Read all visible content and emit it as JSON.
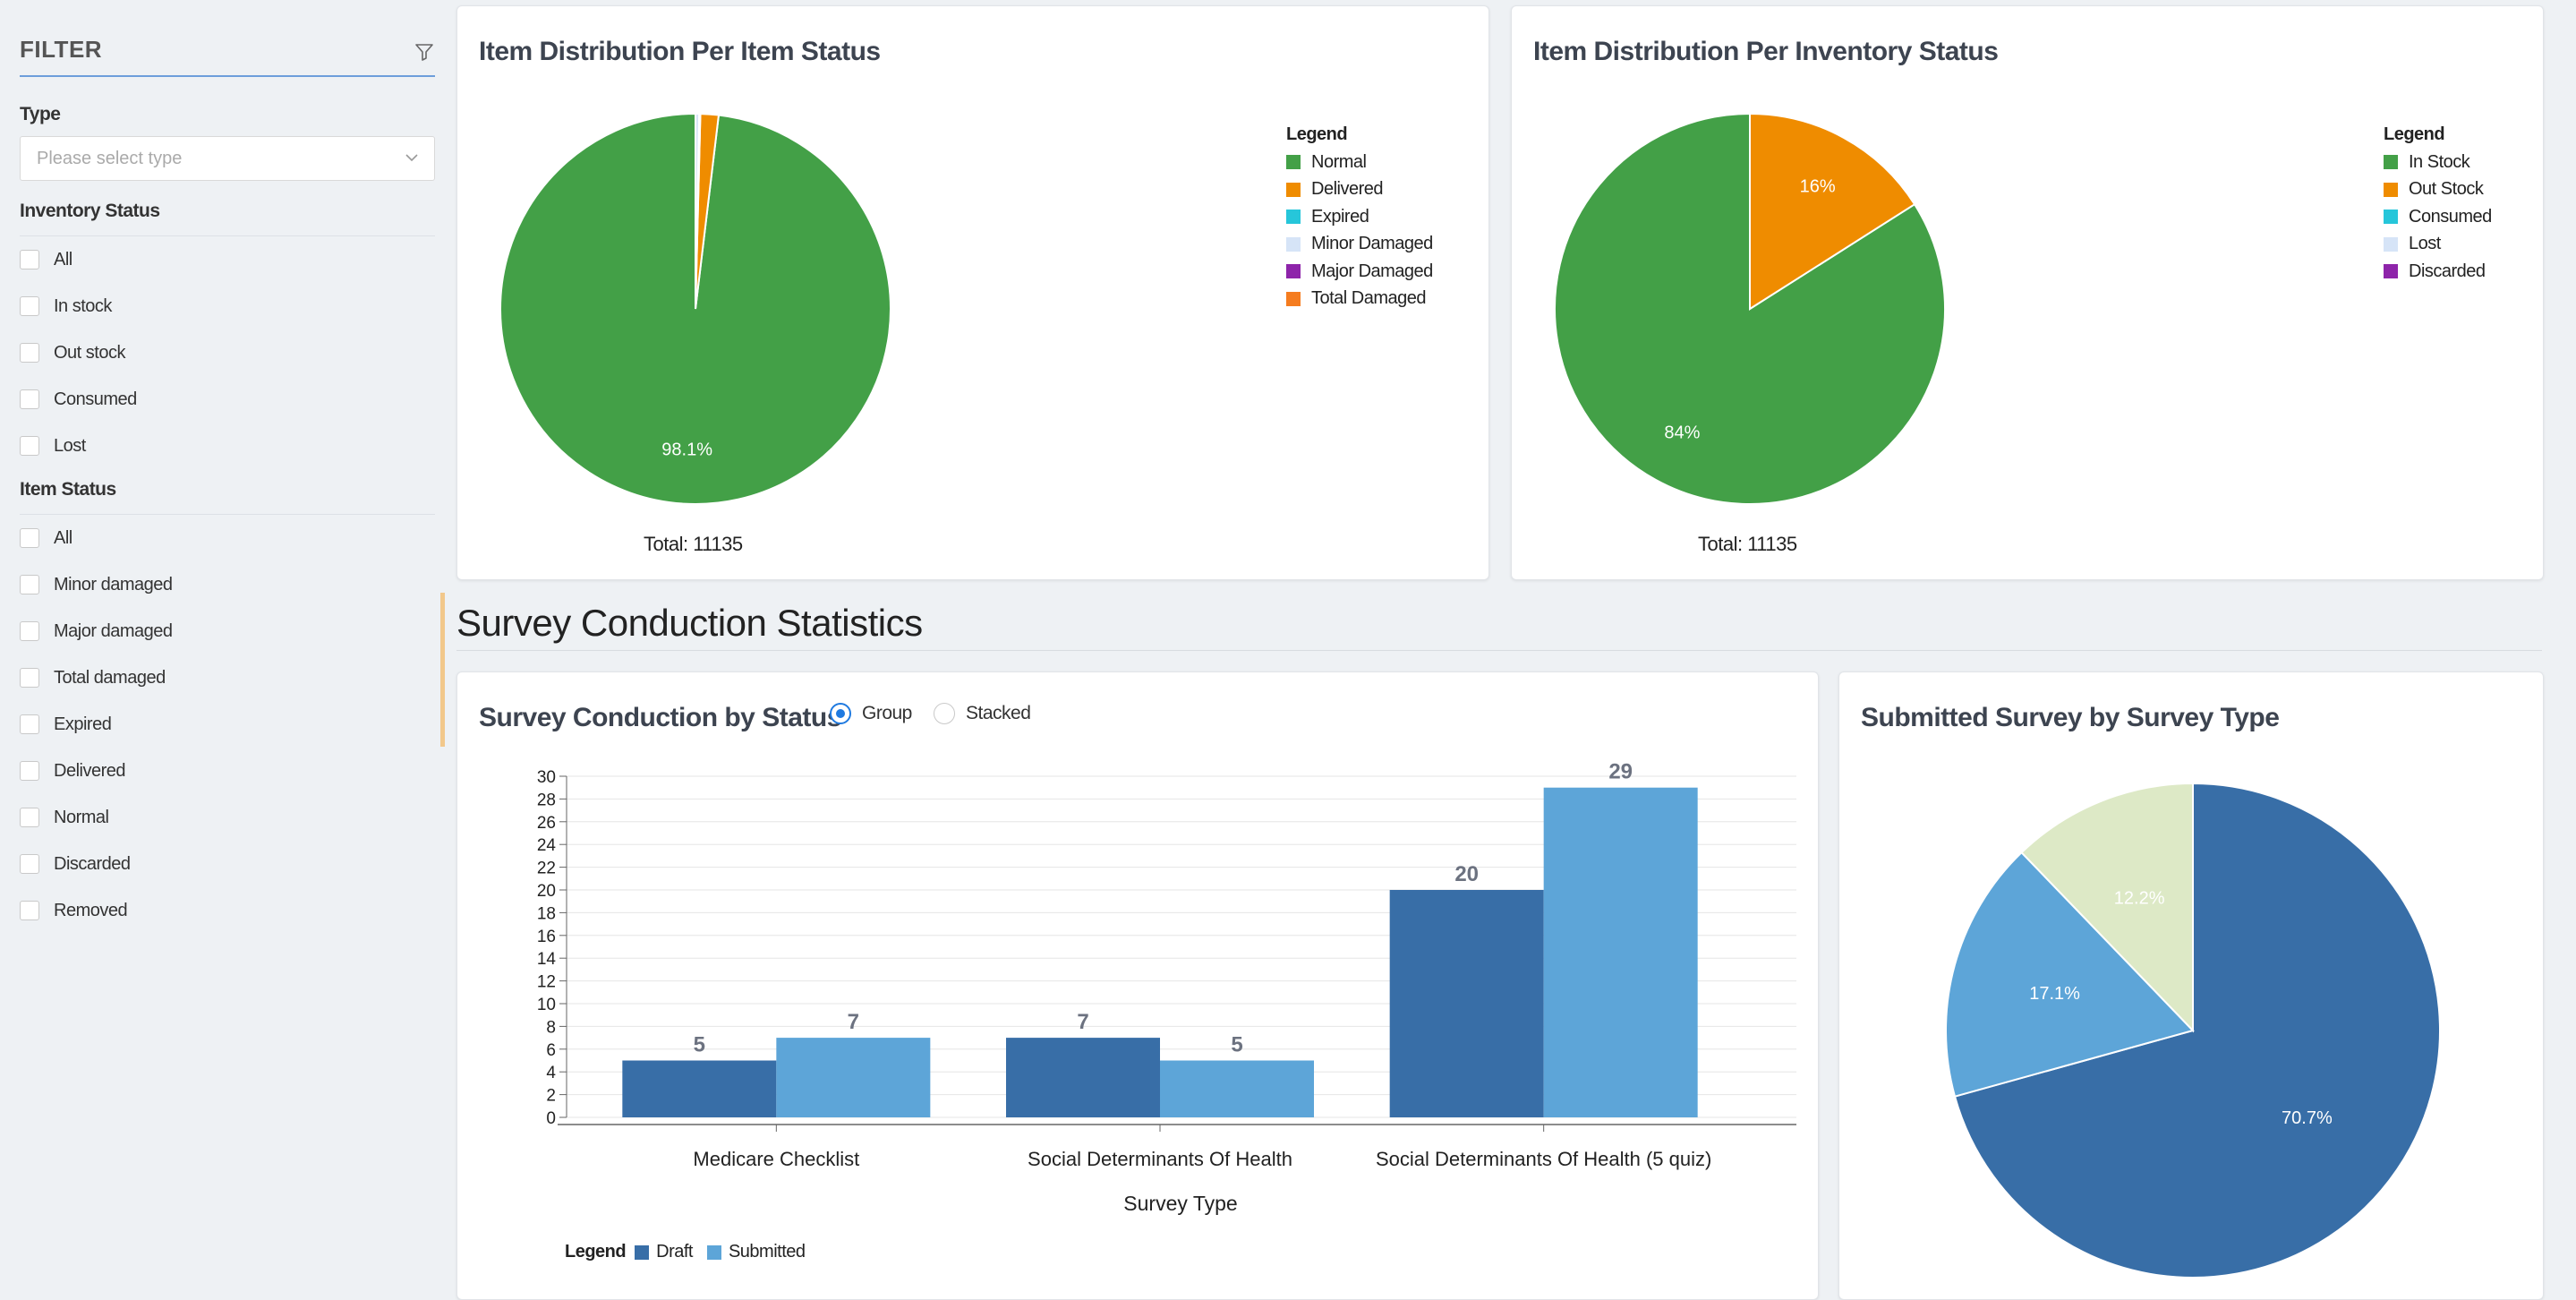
{
  "sidebar": {
    "title": "FILTER",
    "type_label": "Type",
    "type_placeholder": "Please select type",
    "inventory_status_label": "Inventory Status",
    "inventory_status_options": [
      "All",
      "In stock",
      "Out stock",
      "Consumed",
      "Lost"
    ],
    "item_status_label": "Item Status",
    "item_status_options": [
      "All",
      "Minor damaged",
      "Major damaged",
      "Total damaged",
      "Expired",
      "Delivered",
      "Normal",
      "Discarded",
      "Removed"
    ]
  },
  "cards": {
    "item_status": {
      "title": "Item Distribution Per Item Status",
      "legend_title": "Legend",
      "total": "Total: 11135"
    },
    "inventory_status": {
      "title": "Item Distribution Per Inventory Status",
      "legend_title": "Legend",
      "total": "Total: 11135"
    },
    "survey_by_status": {
      "title": "Survey Conduction by Status",
      "radio_group": "Group",
      "radio_stacked": "Stacked",
      "legend_title": "Legend"
    },
    "submitted_by_type": {
      "title": "Submitted Survey by Survey Type"
    }
  },
  "section_title": "Survey Conduction Statistics",
  "chart_data": [
    {
      "type": "pie",
      "title": "Item Distribution Per Item Status",
      "categories": [
        "Normal",
        "Delivered",
        "Expired",
        "Minor Damaged",
        "Major Damaged",
        "Total Damaged"
      ],
      "values": [
        98.1,
        1.5,
        0.1,
        0.3,
        0,
        0
      ],
      "colors": [
        "#43a047",
        "#ef8c00",
        "#26c6da",
        "#d6e4f7",
        "#8e24aa",
        "#f57c1f"
      ],
      "data_labels": [
        "98.1%",
        "",
        "",
        "",
        "",
        ""
      ],
      "legend": "top-right"
    },
    {
      "type": "pie",
      "title": "Item Distribution Per Inventory Status",
      "categories": [
        "In Stock",
        "Out Stock",
        "Consumed",
        "Lost",
        "Discarded"
      ],
      "values": [
        84,
        16,
        0,
        0,
        0
      ],
      "colors": [
        "#43a047",
        "#ef8c00",
        "#26c6da",
        "#d6e4f7",
        "#8e24aa"
      ],
      "data_labels": [
        "84%",
        "16%",
        "",
        "",
        ""
      ],
      "legend": "top-right"
    },
    {
      "type": "bar",
      "title": "Survey Conduction by Status",
      "categories": [
        "Medicare Checklist",
        "Social Determinants Of Health",
        "Social Determinants Of Health (5 quiz)"
      ],
      "series": [
        {
          "name": "Draft",
          "values": [
            5,
            7,
            20
          ],
          "color": "#386ea7"
        },
        {
          "name": "Submitted",
          "values": [
            7,
            5,
            29
          ],
          "color": "#5da5d8"
        }
      ],
      "xlabel": "Survey Type",
      "ylabel": "",
      "ylim": [
        0,
        30
      ],
      "yticks": [
        0,
        2,
        4,
        6,
        8,
        10,
        12,
        14,
        16,
        18,
        20,
        22,
        24,
        26,
        28,
        30
      ],
      "grid": true,
      "legend": "bottom-left"
    },
    {
      "type": "pie",
      "title": "Submitted Survey by Survey Type",
      "values": [
        70.7,
        17.1,
        12.2
      ],
      "colors": [
        "#386ea7",
        "#5da5d8",
        "#dde9c6"
      ],
      "data_labels": [
        "70.7%",
        "17.1%",
        "12.2%"
      ]
    }
  ]
}
